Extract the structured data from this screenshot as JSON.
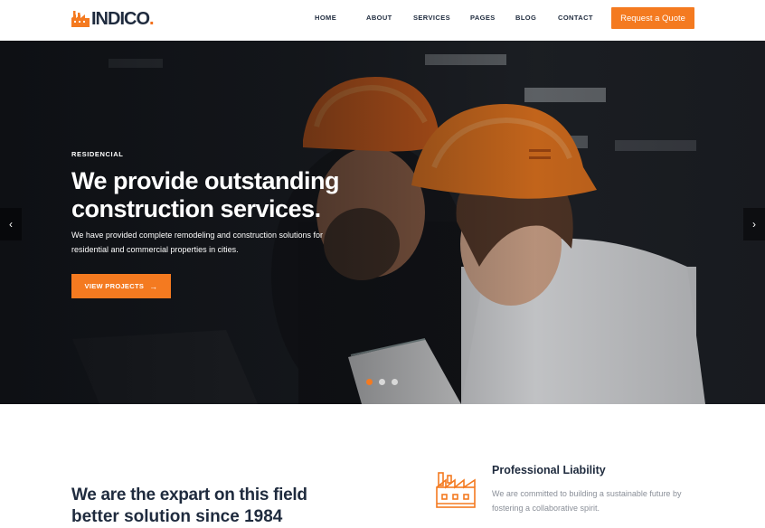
{
  "header": {
    "logo_text": "INDICO",
    "logo_dot": ".",
    "nav": [
      {
        "label": "HOME"
      },
      {
        "label": "ABOUT"
      },
      {
        "label": "SERVICES"
      },
      {
        "label": "PAGES"
      },
      {
        "label": "BLOG"
      },
      {
        "label": "CONTACT"
      }
    ],
    "quote_button": "Request a Quote"
  },
  "hero": {
    "eyebrow": "RESIDENCIAL",
    "title": "We provide outstanding construction services.",
    "description": "We have provided complete remodeling and construction solutions for residential and commercial properties in cities.",
    "cta_label": "VIEW PROJECTS",
    "cta_icon": "arrow-right-icon",
    "slide_count": 3,
    "active_slide": 1,
    "prev_arrow": "‹",
    "next_arrow": "›"
  },
  "about": {
    "title_line1": "We are the expart on this field",
    "title_line2": "better solution since 1984"
  },
  "feature": {
    "title": "Professional Liability",
    "description": "We are committed to building a sustainable future by fostering a collaborative spirit.",
    "icon": "factory-icon"
  },
  "colors": {
    "accent": "#f47a20",
    "dark": "#1f2b3e",
    "muted": "#8a8f98"
  }
}
